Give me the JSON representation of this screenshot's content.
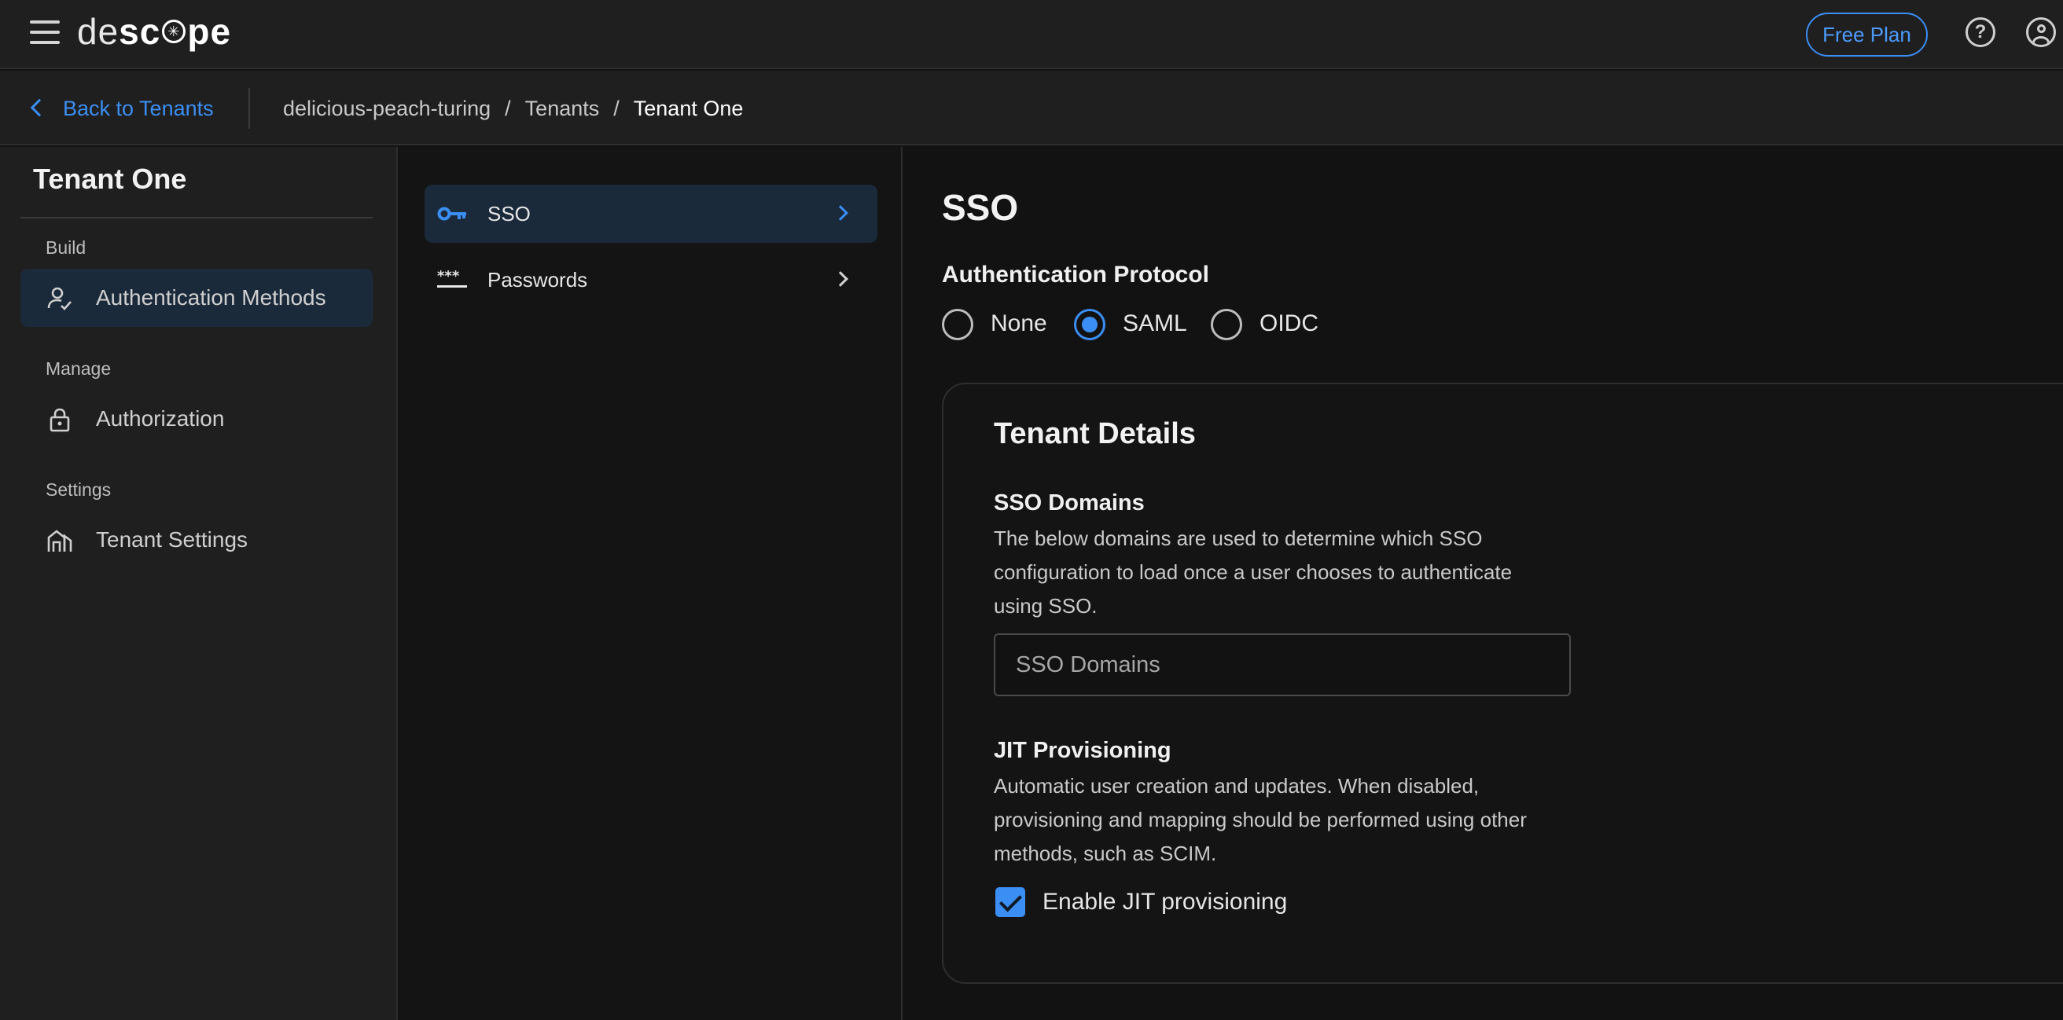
{
  "header": {
    "logo_left": "de",
    "logo_mid": "sc",
    "logo_right": "pe",
    "free_plan_label": "Free Plan",
    "help_icon": "?"
  },
  "breadcrumbs": {
    "back_label": "Back to Tenants",
    "items": [
      "delicious-peach-turing",
      "Tenants",
      "Tenant One"
    ]
  },
  "sidebar": {
    "title": "Tenant One",
    "sections": [
      {
        "label": "Build",
        "items": [
          {
            "label": "Authentication Methods",
            "icon": "user-check-icon",
            "active": true
          }
        ]
      },
      {
        "label": "Manage",
        "items": [
          {
            "label": "Authorization",
            "icon": "lock-icon",
            "active": false
          }
        ]
      },
      {
        "label": "Settings",
        "items": [
          {
            "label": "Tenant Settings",
            "icon": "building-icon",
            "active": false
          }
        ]
      }
    ]
  },
  "subnav": {
    "items": [
      {
        "label": "SSO",
        "icon": "key-icon",
        "active": true
      },
      {
        "label": "Passwords",
        "icon": "password-icon",
        "active": false
      }
    ]
  },
  "main": {
    "title": "SSO",
    "protocol_label": "Authentication Protocol",
    "protocols": [
      {
        "label": "None",
        "checked": false
      },
      {
        "label": "SAML",
        "checked": true
      },
      {
        "label": "OIDC",
        "checked": false
      }
    ],
    "card": {
      "title": "Tenant Details",
      "sso_domains_label": "SSO Domains",
      "sso_domains_desc_1": "The below domains are used to determine which SSO",
      "sso_domains_desc_2": "configuration to load once a user chooses to authenticate",
      "sso_domains_desc_3": "using SSO.",
      "sso_domains_placeholder": "SSO Domains",
      "sso_domains_value": "",
      "jit_label": "JIT Provisioning",
      "jit_desc_1": "Automatic user creation and updates. When disabled,",
      "jit_desc_2": "provisioning and mapping should be performed using other",
      "jit_desc_3": "methods, such as SCIM.",
      "jit_checkbox_label": "Enable JIT provisioning",
      "jit_enabled": true
    }
  },
  "colors": {
    "accent": "#3b8ef3",
    "background": "#121212",
    "panel": "#1f1f1f",
    "active_item": "#1b2a3b"
  }
}
